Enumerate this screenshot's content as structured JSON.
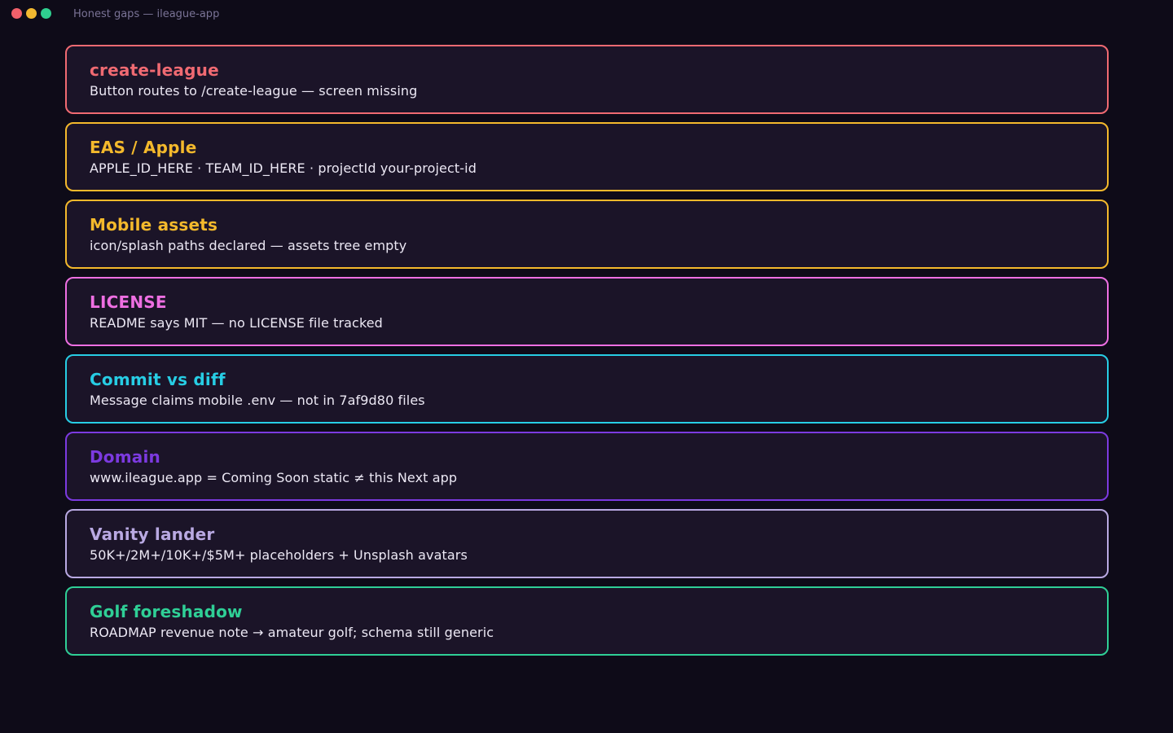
{
  "window": {
    "title": "Honest gaps — ileague-app",
    "controls": [
      {
        "name": "close-dot",
        "color": "#f0606a"
      },
      {
        "name": "minimize-dot",
        "color": "#f2b830"
      },
      {
        "name": "maximize-dot",
        "color": "#2fcf8f"
      }
    ]
  },
  "cards": [
    {
      "id": "create-league",
      "title": "create-league",
      "desc": "Button routes to /create-league — screen missing",
      "color": "#f06a72"
    },
    {
      "id": "eas-apple",
      "title": "EAS / Apple",
      "desc": "APPLE_ID_HERE · TEAM_ID_HERE · projectId your-project-id",
      "color": "#f4b92c"
    },
    {
      "id": "mobile-assets",
      "title": "Mobile assets",
      "desc": "icon/splash paths declared — assets tree empty",
      "color": "#f4b92c"
    },
    {
      "id": "license",
      "title": "LICENSE",
      "desc": "README says MIT — no LICENSE file tracked",
      "color": "#ee6fe2"
    },
    {
      "id": "commit-vs-diff",
      "title": "Commit vs diff",
      "desc": "Message claims mobile .env — not in 7af9d80 files",
      "color": "#27cde4"
    },
    {
      "id": "domain",
      "title": "Domain",
      "desc": "www.ileague.app = Coming Soon static ≠ this Next app",
      "color": "#7c3ae0"
    },
    {
      "id": "vanity-lander",
      "title": "Vanity lander",
      "desc": "50K+/2M+/10K+/$5M+ placeholders + Unsplash avatars",
      "color": "#b9a9e2"
    },
    {
      "id": "golf-foreshadow",
      "title": "Golf foreshadow",
      "desc": "ROADMAP revenue note → amateur golf; schema still generic",
      "color": "#2fcf96"
    }
  ]
}
